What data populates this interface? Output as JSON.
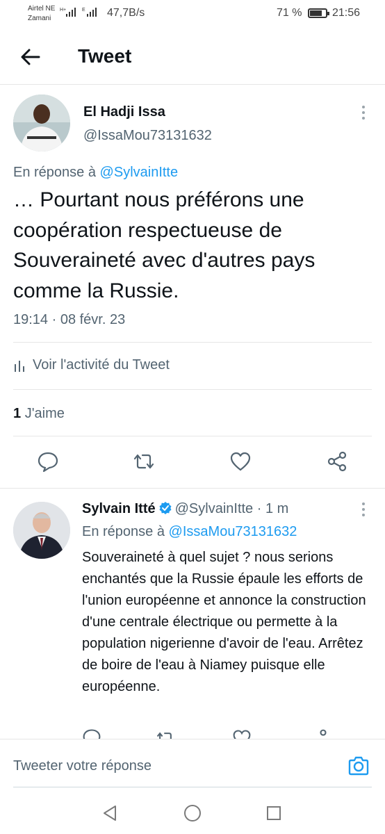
{
  "status_bar": {
    "carrier_line1": "Airtel NE",
    "carrier_line2": "Zamani",
    "network_speed": "47,7B/s",
    "battery": "71 %",
    "time": "21:56"
  },
  "header": {
    "title": "Tweet"
  },
  "main_tweet": {
    "author_name": "El Hadji Issa",
    "author_handle": "@IssaMou73131632",
    "reply_prefix": "En réponse à",
    "reply_mention": "@SylvainItte",
    "text": "… Pourtant nous préférons une coopération respectueuse de Souveraineté avec d'autres pays comme la Russie.",
    "timestamp": "19:14 · 08 févr. 23",
    "activity_link": "Voir l'activité du Tweet",
    "likes_count": "1",
    "likes_label": "J'aime"
  },
  "reply_tweet": {
    "author_name": "Sylvain Itté",
    "author_meta": "@SylvainItte · 1 m",
    "reply_prefix": "En réponse à",
    "reply_mention": "@IssaMou73131632",
    "text": "Souveraineté à quel sujet ? nous serions enchantés que la Russie épaule les efforts de l'union européenne et annonce la construction d'une centrale électrique ou permette à la population nigerienne d'avoir de l'eau. Arrêtez de boire de l'eau à Niamey puisque elle européenne."
  },
  "compose": {
    "placeholder": "Tweeter votre réponse"
  },
  "colors": {
    "accent": "#1d9bf0",
    "text": "#0f1419",
    "secondary": "#536471"
  }
}
